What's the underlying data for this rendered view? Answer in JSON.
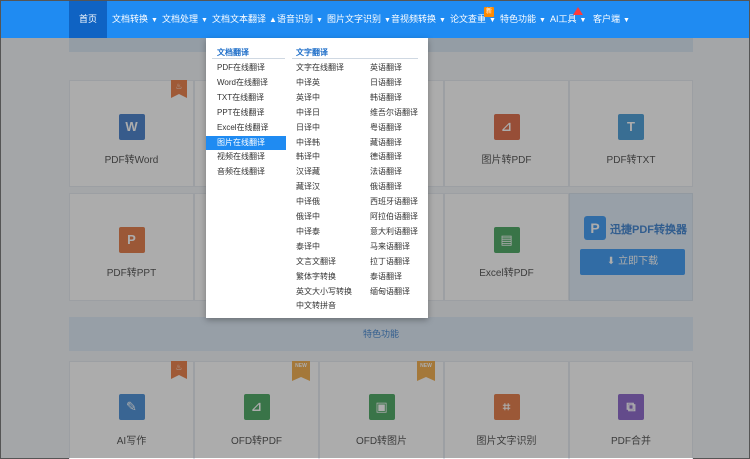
{
  "nav": {
    "items": [
      {
        "label": "首页",
        "caret": ""
      },
      {
        "label": "文档转换",
        "caret": "▼"
      },
      {
        "label": "文档处理",
        "caret": "▼"
      },
      {
        "label": "文档文本翻译",
        "caret": "▲"
      },
      {
        "label": "语音识别",
        "caret": "▼"
      },
      {
        "label": "图片文字识别",
        "caret": "▼"
      },
      {
        "label": "音视频转换",
        "caret": "▼"
      },
      {
        "label": "论文查重",
        "caret": "▼"
      },
      {
        "label": "特色功能",
        "caret": "▼"
      },
      {
        "label": "AI工具",
        "caret": "▼"
      },
      {
        "label": "客户端",
        "caret": "▼"
      }
    ],
    "new_badge": "新"
  },
  "dropdown": {
    "doc_heading": "文档翻译",
    "text_heading": "文字翻译",
    "doc_items": [
      "PDF在线翻译",
      "Word在线翻译",
      "TXT在线翻译",
      "PPT在线翻译",
      "Excel在线翻译",
      "图片在线翻译",
      "视频在线翻译",
      "音频在线翻译"
    ],
    "text_col1": [
      "文字在线翻译",
      "中译英",
      "英译中",
      "中译日",
      "日译中",
      "中译韩",
      "韩译中",
      "汉译藏",
      "藏译汉",
      "中译俄",
      "俄译中",
      "中译泰",
      "泰译中",
      "文言文翻译",
      "繁体字转换",
      "英文大小写转换",
      "中文转拼音"
    ],
    "text_col2": [
      "英语翻译",
      "日语翻译",
      "韩语翻译",
      "维吾尔语翻译",
      "粤语翻译",
      "藏语翻译",
      "德语翻译",
      "法语翻译",
      "俄语翻译",
      "西班牙语翻译",
      "阿拉伯语翻译",
      "意大利语翻译",
      "马来语翻译",
      "拉丁语翻译",
      "泰语翻译",
      "缅甸语翻译"
    ]
  },
  "cards_row1": [
    {
      "label": "PDF转Word",
      "icon": "W",
      "color": "#2b6cc4"
    },
    {
      "label": "图片转PDF",
      "icon": "⊿",
      "color": "#d9542b"
    },
    {
      "label": "PDF转TXT",
      "icon": "T",
      "color": "#2f8fd1"
    }
  ],
  "cards_row2": [
    {
      "label": "PDF转PPT",
      "icon": "P",
      "color": "#e0672b"
    },
    {
      "label": "Excel转PDF",
      "icon": "▤",
      "color": "#2e9a4a"
    }
  ],
  "promo": {
    "name": "迅捷PDF转换器",
    "download": "⬇ 立即下载",
    "logo": "P"
  },
  "section": {
    "label": "特色功能"
  },
  "cards_row3": [
    {
      "label": "AI写作",
      "icon": "✎",
      "color": "#2f7fd1",
      "tag": "hot"
    },
    {
      "label": "OFD转PDF",
      "icon": "⊿",
      "color": "#2e9a4a",
      "tag": "NEW"
    },
    {
      "label": "OFD转图片",
      "icon": "▣",
      "color": "#2e9a4a",
      "tag": "NEW"
    },
    {
      "label": "图片文字识别",
      "icon": "⌗",
      "color": "#e0672b",
      "tag": ""
    },
    {
      "label": "PDF合并",
      "icon": "⧉",
      "color": "#7a4fc4",
      "tag": ""
    }
  ]
}
